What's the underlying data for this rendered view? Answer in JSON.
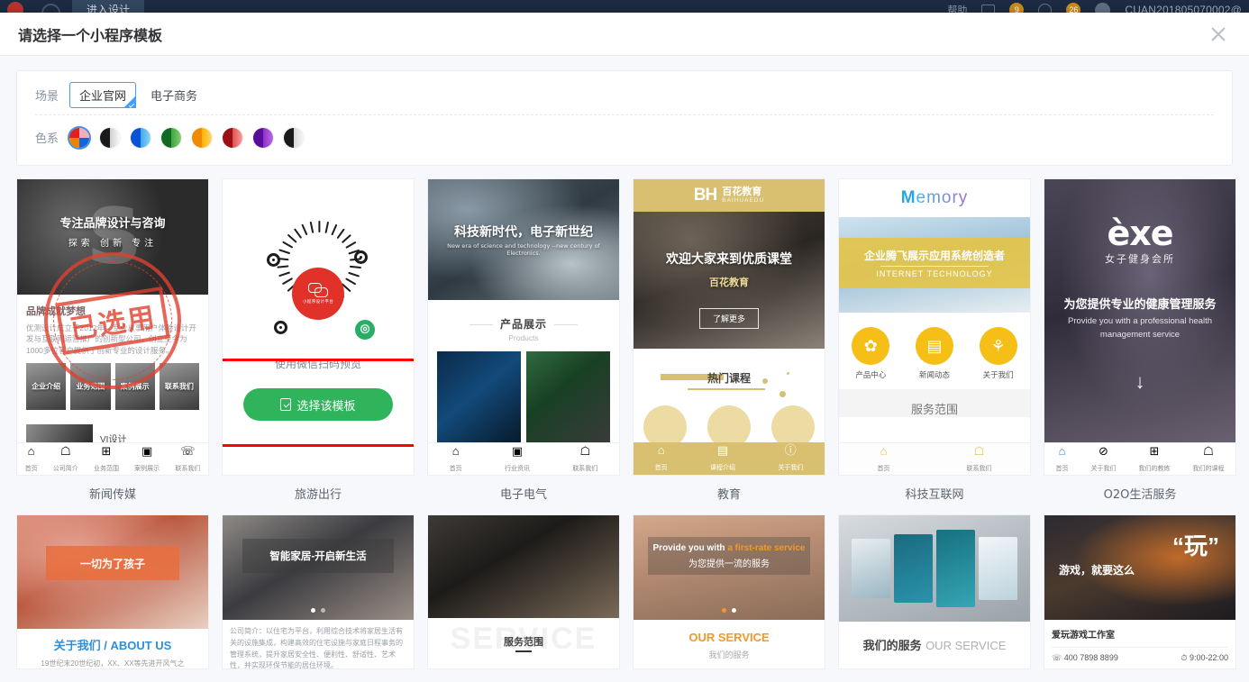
{
  "background_app": {
    "entry_button_label": "进入设计",
    "right_label": "帮助",
    "notification_count": "9",
    "message_count": "26",
    "account": "CUAN201805070002@"
  },
  "modal": {
    "title": "请选择一个小程序模板",
    "close_icon": "close-icon"
  },
  "filters": {
    "scene": {
      "label": "场景",
      "options": [
        {
          "label": "企业官网",
          "selected": true
        },
        {
          "label": "电子商务",
          "selected": false
        }
      ]
    },
    "color": {
      "label": "色系",
      "swatches": [
        {
          "name": "multicolor",
          "selected": true,
          "colors": [
            "#e02020",
            "#f0a8b4",
            "#f08200",
            "#1664d8"
          ]
        },
        {
          "name": "black-white",
          "selected": false,
          "colors": [
            "#1a1a1a",
            "#f0f0f0"
          ]
        },
        {
          "name": "blue",
          "selected": false,
          "colors": [
            "#0a52d6",
            "#4fb4f0"
          ]
        },
        {
          "name": "green",
          "selected": false,
          "colors": [
            "#0f6b22",
            "#5cbe5c"
          ]
        },
        {
          "name": "orange",
          "selected": false,
          "colors": [
            "#f08a00",
            "#ffc233"
          ]
        },
        {
          "name": "red",
          "selected": false,
          "colors": [
            "#9c0d14",
            "#f26a6a"
          ]
        },
        {
          "name": "purple",
          "selected": false,
          "colors": [
            "#5a0d9c",
            "#9b3fd4"
          ]
        },
        {
          "name": "grey",
          "selected": false,
          "colors": [
            "#1a1a1a",
            "#eaeaea"
          ]
        }
      ]
    }
  },
  "templates": [
    {
      "label": "新闻传媒",
      "state": "used",
      "stamp_text": "已选用",
      "hero_title": "专注品牌设计与咨询",
      "hero_sub": "探索 创新 专注",
      "section_title": "品牌成就梦想",
      "body_text": "优测设计成立于2012年，专业从事用户体验设计开发与互联网运营推广的创新型公司，创立至今为1000多位客户提供了创新专业的设计服务。",
      "tiles": [
        "企业介绍",
        "业务范围",
        "案例展示",
        "联系我们"
      ],
      "strip_title": "VI设计",
      "nav": [
        "首页",
        "公司简介",
        "业务范围",
        "案例展示",
        "联系我们"
      ]
    },
    {
      "label": "旅游出行",
      "state": "preview",
      "qr_caption": "使用微信扫码预览",
      "qr_center_text": "小程序设计平台",
      "select_button_label": "选择该模板",
      "annotation": "red-highlight-box"
    },
    {
      "label": "电子电气",
      "hero_title": "科技新时代，电子新世纪",
      "hero_sub": "New era of science and technology --new century of Electronics.",
      "section_title": "产品展示",
      "section_sub": "Products",
      "nav": [
        "首页",
        "行业资讯",
        "联系我们"
      ]
    },
    {
      "label": "教育",
      "brand_logo": "BH",
      "brand_cn": "百花教育",
      "brand_en": "BAIHUAEDU",
      "hero_title": "欢迎大家来到优质课堂",
      "hero_sub": "百花教育",
      "hero_button": "了解更多",
      "section_title": "热门课程",
      "nav": [
        "首页",
        "课程介绍",
        "关于我们"
      ]
    },
    {
      "label": "科技互联网",
      "brand_m": "M",
      "brand_rest": "emory",
      "hero_title": "企业腾飞展示应用系统创造者",
      "hero_sub": "INTERNET TECHNOLOGY",
      "icons": [
        {
          "label": "产品中心",
          "glyph": "✿"
        },
        {
          "label": "新闻动态",
          "glyph": "▤"
        },
        {
          "label": "关于我们",
          "glyph": "⚘"
        }
      ],
      "section_title": "服务范围",
      "nav": [
        "首页",
        "联系我们"
      ]
    },
    {
      "label": "O2O生活服务",
      "brand": "èxe",
      "brand_sub": "女子健身会所",
      "hero_title": "为您提供专业的健康管理服务",
      "hero_sub": "Provide you with a professional health management service",
      "nav": [
        "首页",
        "关于我们",
        "我们的教练",
        "我们的课程"
      ]
    }
  ],
  "templates_row2": [
    {
      "banner_text": "一切为了孩子",
      "footer_title": "关于我们 / ABOUT US",
      "footer_text": "19世纪末20世纪初，XX、XX等先进开风气之"
    },
    {
      "banner_text": "智能家居-开启新生活",
      "body_text": "公司简介：以住宅为平台，利用综合技术将家居生活有关的设施集成，构建高效的住宅设施与家庭日程事务的管理系统，提升家居安全性、便利性、舒适性、艺术性，并实现环保节能的居住环境。"
    },
    {
      "ghost_text": "SERVICE",
      "footer_title": "服务范围"
    },
    {
      "banner_en_pre": "Provide you with ",
      "banner_en_hi": "a first-rate service",
      "banner_cn": "为您提供一流的服务",
      "footer_title": "OUR SERVICE",
      "footer_sub": "我们的服务"
    },
    {
      "footer_cn": "我们的服务",
      "footer_en": "OUR SERVICE"
    },
    {
      "banner_quote": "“玩”",
      "banner_cn": "游戏，就要这么",
      "footer_title": "爱玩游戏工作室",
      "phone": "400 7898 8899",
      "hours": "9:00-22:00"
    }
  ]
}
